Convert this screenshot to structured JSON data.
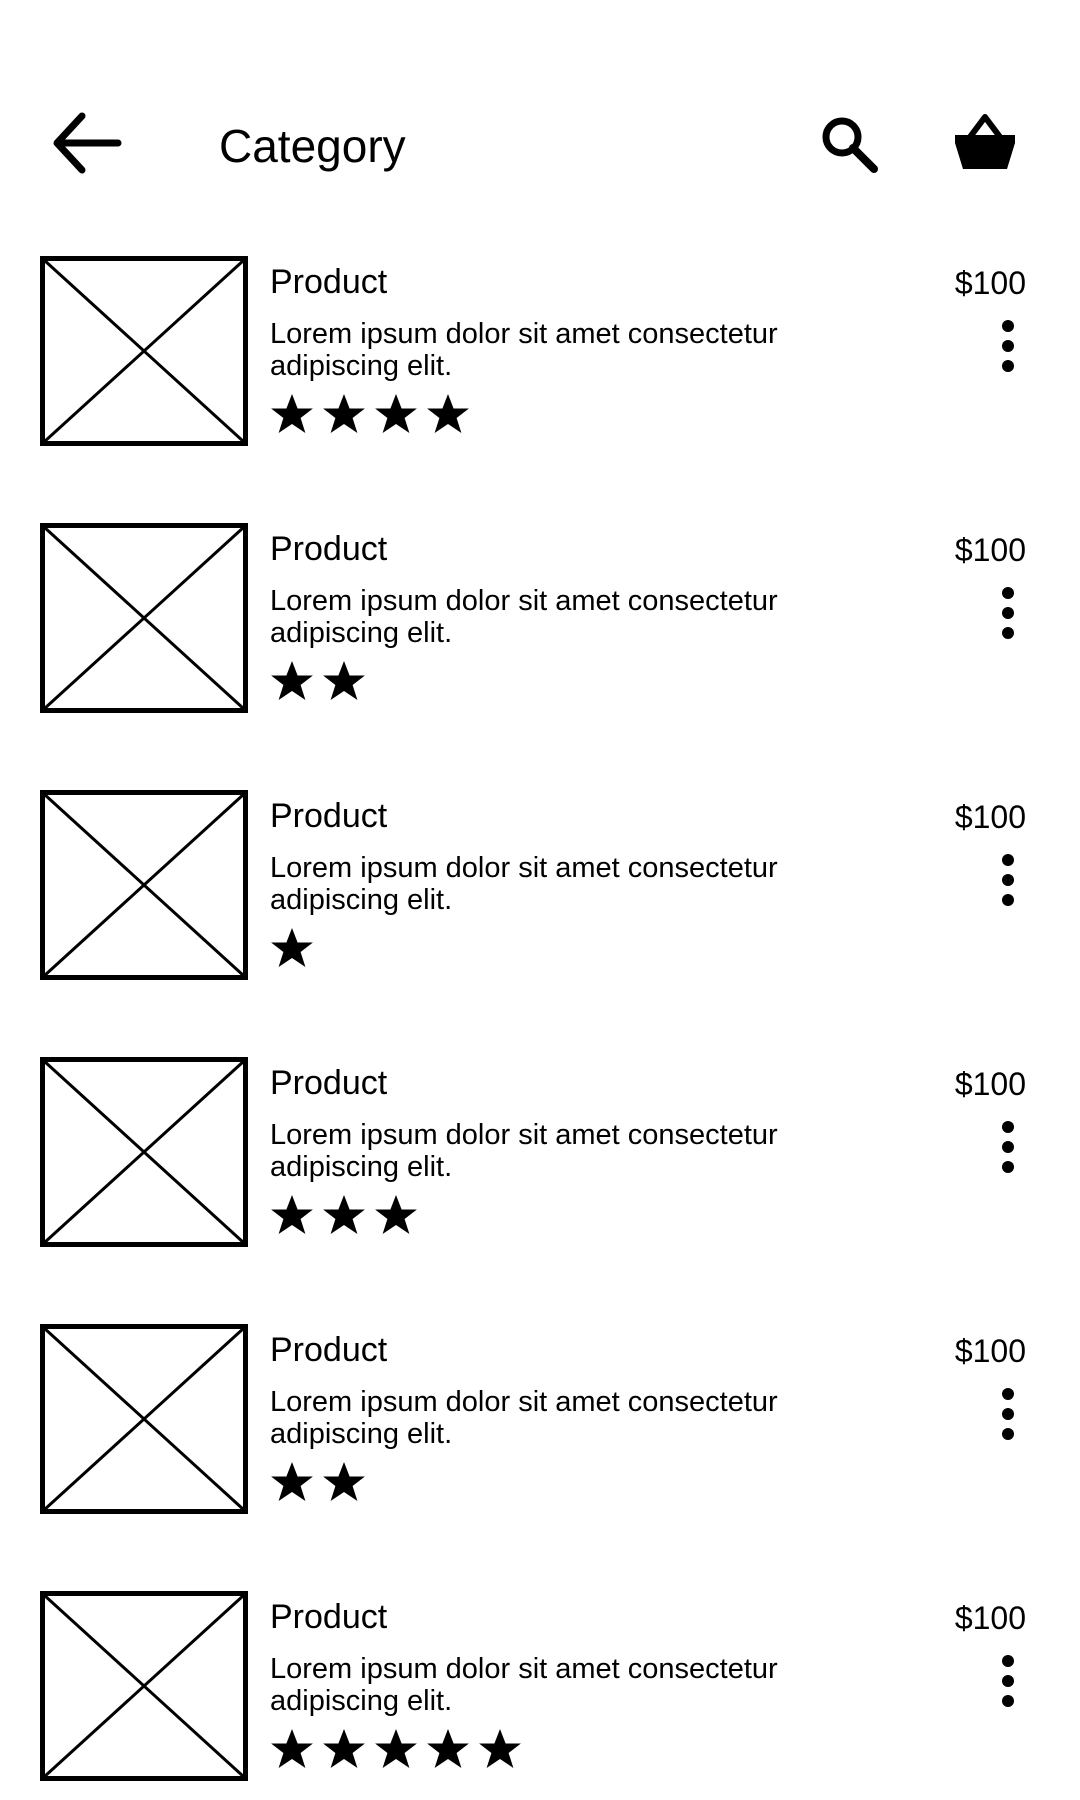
{
  "header": {
    "title": "Category",
    "icons": {
      "back": "arrow-left-icon",
      "search": "search-icon",
      "cart": "shopping-basket-icon"
    }
  },
  "products": [
    {
      "name": "Product",
      "price": "$100",
      "description": "Lorem ipsum dolor sit amet consectetur adipiscing elit.",
      "rating": 4
    },
    {
      "name": "Product",
      "price": "$100",
      "description": "Lorem ipsum dolor sit amet consectetur adipiscing elit.",
      "rating": 2
    },
    {
      "name": "Product",
      "price": "$100",
      "description": "Lorem ipsum dolor sit amet consectetur adipiscing elit.",
      "rating": 1
    },
    {
      "name": "Product",
      "price": "$100",
      "description": "Lorem ipsum dolor sit amet consectetur adipiscing elit.",
      "rating": 3
    },
    {
      "name": "Product",
      "price": "$100",
      "description": "Lorem ipsum dolor sit amet consectetur adipiscing elit.",
      "rating": 2
    },
    {
      "name": "Product",
      "price": "$100",
      "description": "Lorem ipsum dolor sit amet consectetur adipiscing elit.",
      "rating": 5
    }
  ],
  "item_icons": {
    "image": "image-placeholder-icon",
    "rating": "star-icon",
    "menu": "more-vertical-icon"
  }
}
